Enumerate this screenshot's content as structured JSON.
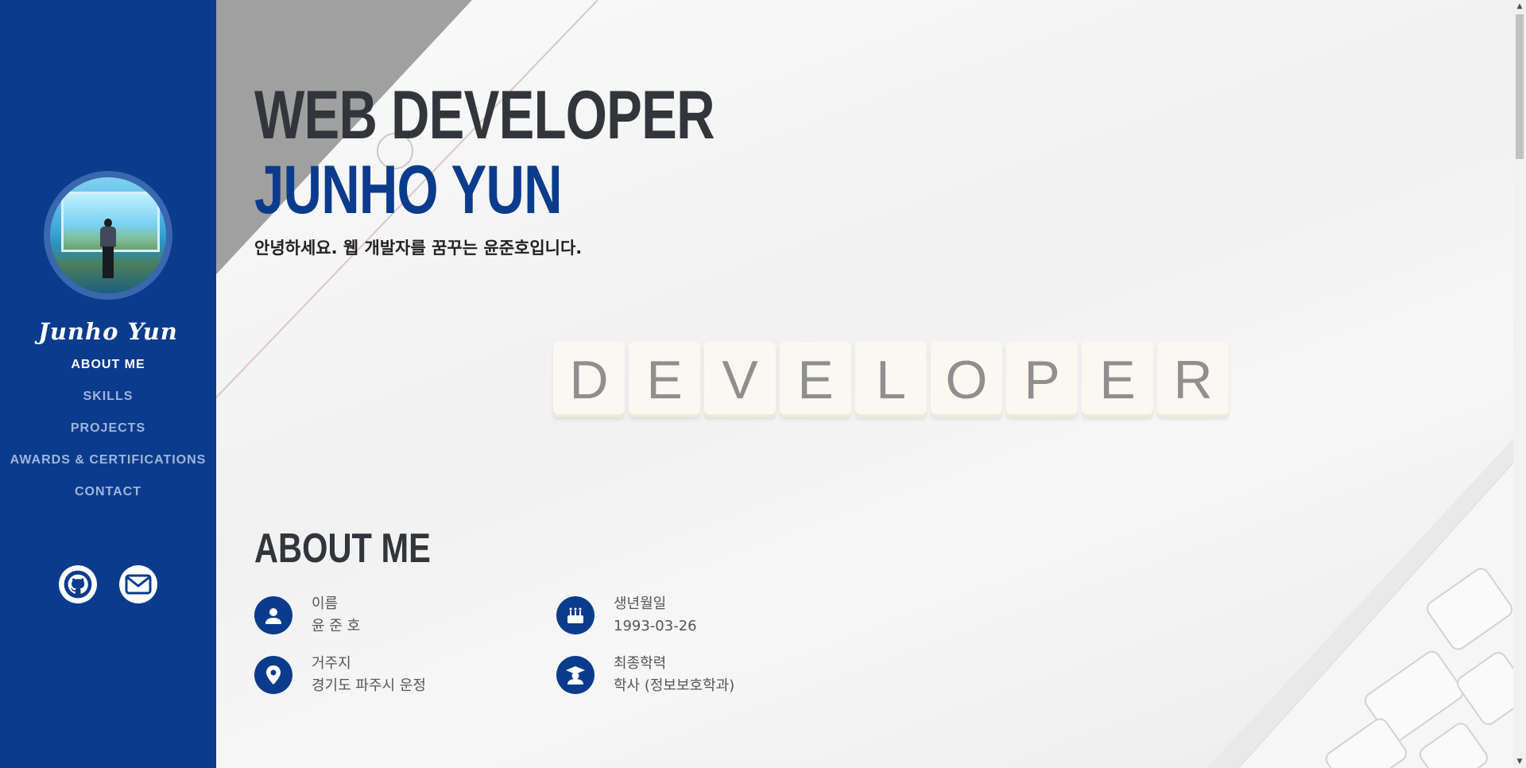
{
  "sidebar": {
    "brand": "Junho Yun",
    "nav": [
      {
        "label": "ABOUT ME",
        "active": true
      },
      {
        "label": "SKILLS",
        "active": false
      },
      {
        "label": "PROJECTS",
        "active": false
      },
      {
        "label": "AWARDS & CERTIFICATIONS",
        "active": false
      },
      {
        "label": "CONTACT",
        "active": false
      }
    ],
    "social": [
      "github-icon",
      "mail-icon"
    ]
  },
  "hero": {
    "line1": "WEB DEVELOPER",
    "line2": "JUNHO YUN",
    "greeting": "안녕하세요. 웹 개발자를 꿈꾸는 윤준호입니다."
  },
  "background_tiles": [
    "D",
    "E",
    "V",
    "E",
    "L",
    "O",
    "P",
    "E",
    "R"
  ],
  "about": {
    "title": "ABOUT ME",
    "items": [
      {
        "icon": "person-icon",
        "label": "이름",
        "value": "윤 준 호"
      },
      {
        "icon": "birthday-cake-icon",
        "label": "생년월일",
        "value": "1993-03-26"
      },
      {
        "icon": "location-pin-icon",
        "label": "거주지",
        "value": "경기도 파주시 운정"
      },
      {
        "icon": "graduate-icon",
        "label": "최종학력",
        "value": "학사 (정보보호학과)"
      }
    ]
  },
  "colors": {
    "sidebar": "#0b3b8c",
    "accent": "#0b3b8c",
    "heading": "#323539"
  }
}
